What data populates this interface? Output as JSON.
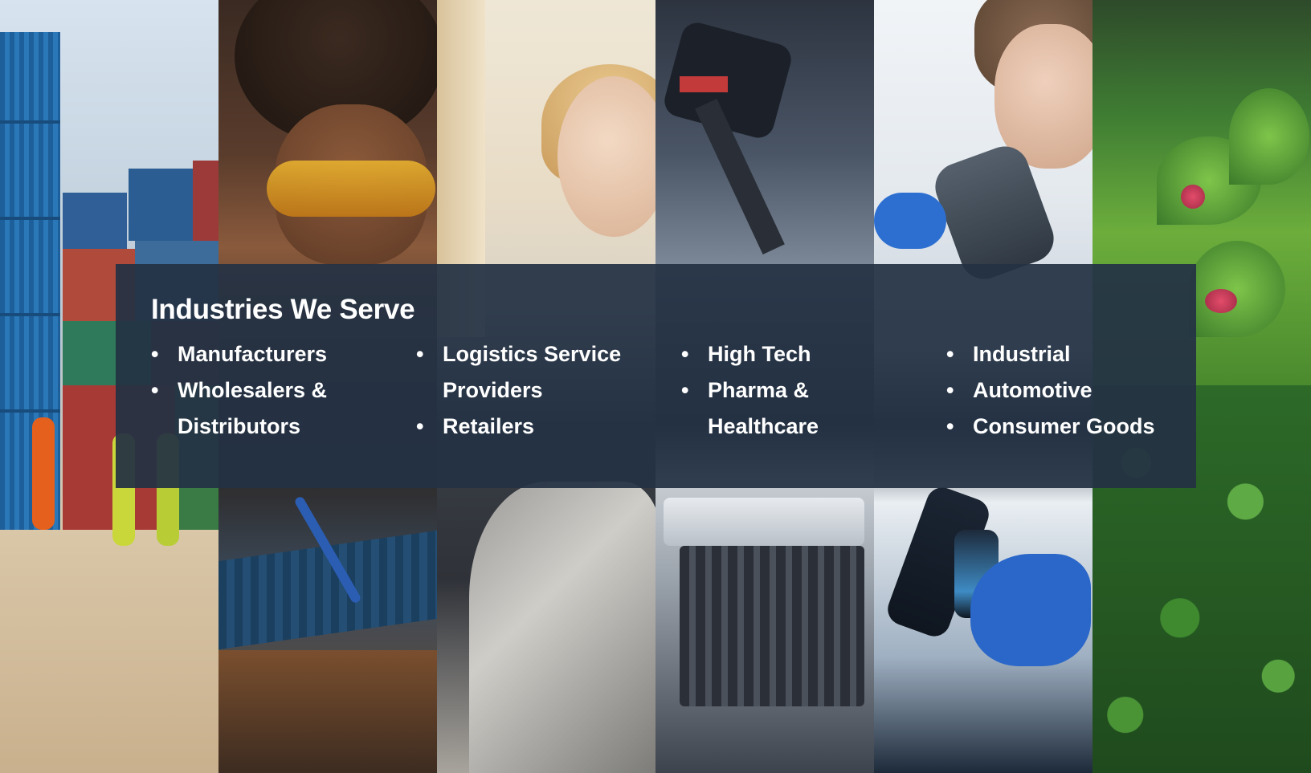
{
  "panels": [
    {
      "name": "shipping-containers-photo"
    },
    {
      "name": "soldering-electronics-photo"
    },
    {
      "name": "retail-woman-photo"
    },
    {
      "name": "automotive-assembly-photo"
    },
    {
      "name": "lab-microscope-photo"
    },
    {
      "name": "fresh-produce-photo"
    }
  ],
  "heading": "Industries We Serve",
  "columns": [
    {
      "items": [
        "Manufacturers",
        "Wholesalers & Distributors"
      ]
    },
    {
      "items": [
        "Logistics Service Providers",
        "Retailers"
      ]
    },
    {
      "items": [
        "High Tech",
        "Pharma & Healthcare"
      ]
    },
    {
      "items": [
        "Industrial",
        "Automotive",
        "Consumer Goods"
      ]
    }
  ],
  "colors": {
    "overlay": "#243244",
    "text": "#ffffff"
  }
}
